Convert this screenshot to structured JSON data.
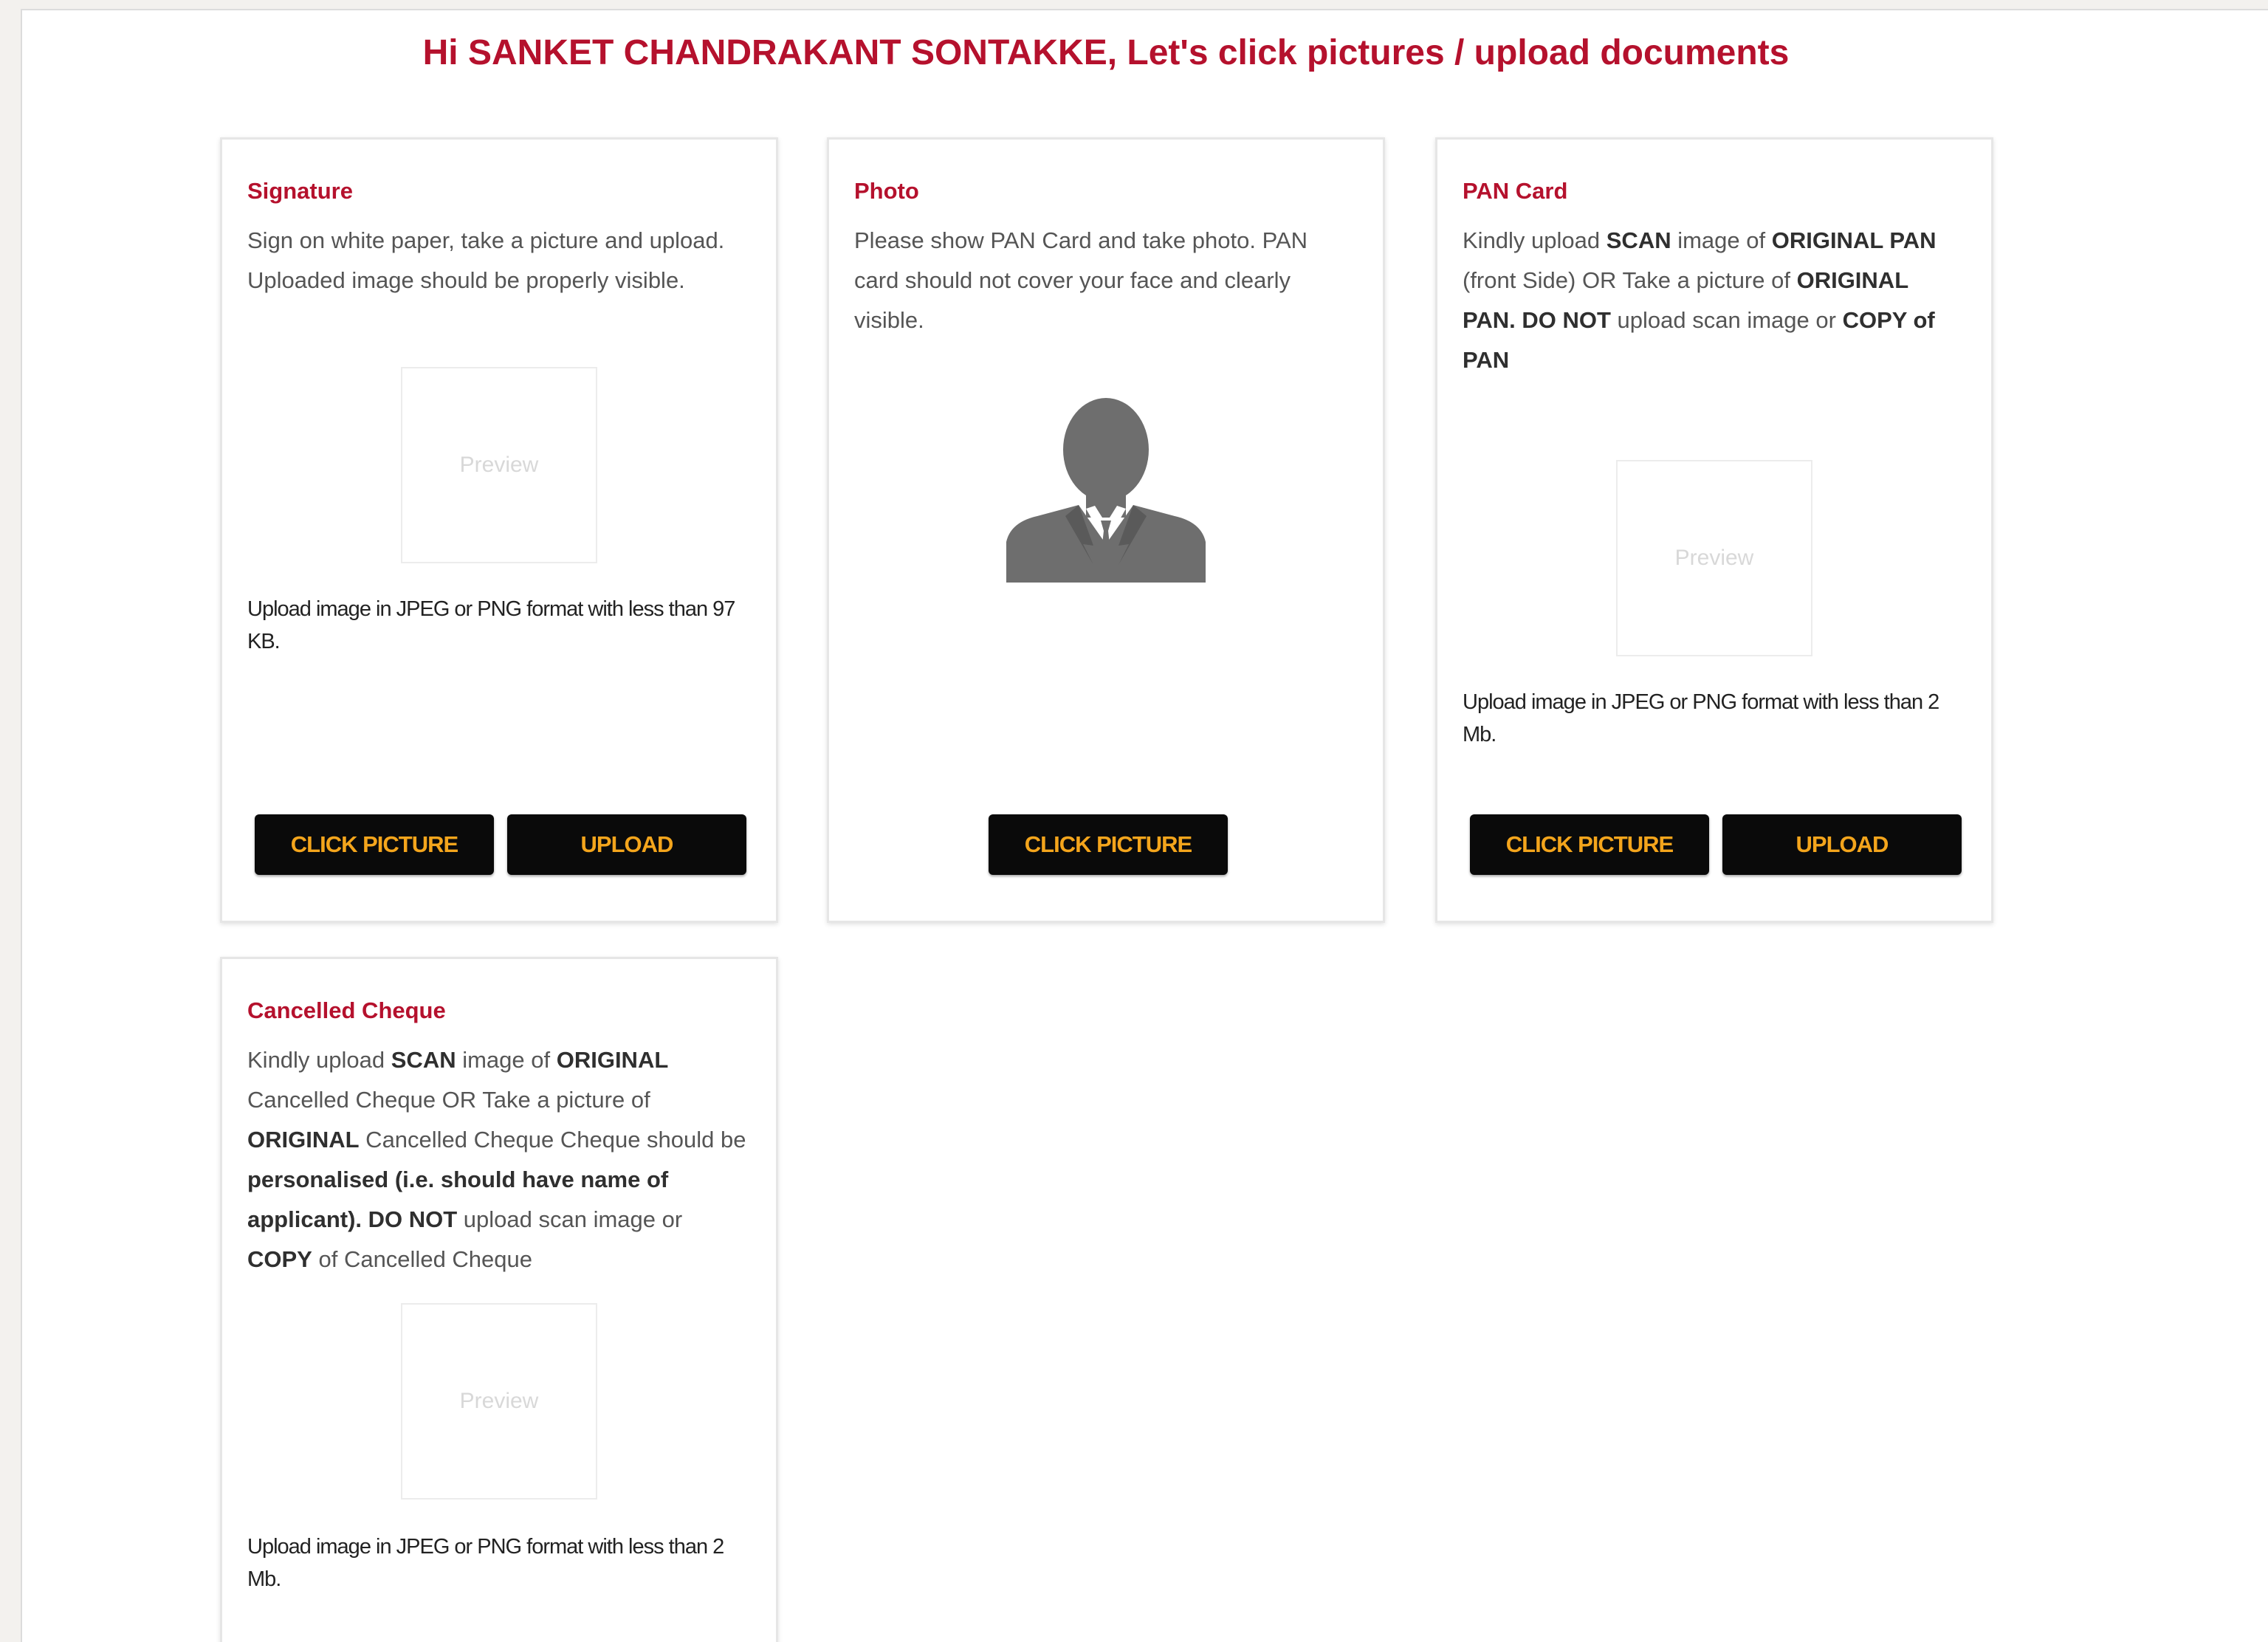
{
  "page": {
    "title": "Hi SANKET CHANDRAKANT SONTAKKE, Let's click pictures / upload documents"
  },
  "colors": {
    "accent": "#b5112d",
    "button_bg": "#0a0a0a",
    "button_text": "#f4a51c"
  },
  "cards": {
    "signature": {
      "title": "Signature",
      "desc": "Sign on white paper, take a picture and upload. Uploaded image should be properly visible.",
      "preview": "Preview",
      "note": "Upload image in JPEG or PNG format with less than 97 KB.",
      "click_label": "CLICK PICTURE",
      "upload_label": "UPLOAD"
    },
    "photo": {
      "title": "Photo",
      "desc": "Please show PAN Card and take photo. PAN card should not cover your face and clearly visible.",
      "avatar_icon": "person-silhouette-icon",
      "click_label": "CLICK PICTURE"
    },
    "pan": {
      "title": "PAN Card",
      "desc": {
        "t1": "Kindly upload ",
        "b1": "SCAN",
        "t2": " image of ",
        "b2": "ORIGINAL PAN",
        "t3": " (front Side) OR Take a picture of ",
        "b3": "ORIGINAL PAN. DO NOT",
        "t4": " upload scan image or ",
        "b4": "COPY of PAN"
      },
      "preview": "Preview",
      "note": "Upload image in JPEG or PNG format with less than 2 Mb.",
      "click_label": "CLICK PICTURE",
      "upload_label": "UPLOAD"
    },
    "cheque": {
      "title": "Cancelled Cheque",
      "desc": {
        "t1": "Kindly upload ",
        "b1": "SCAN",
        "t2": " image of ",
        "b2": "ORIGINAL",
        "t3": " Cancelled Cheque OR Take a picture of ",
        "b3": "ORIGINAL",
        "t4": " Cancelled Cheque Cheque should be ",
        "b4": "personalised (i.e. should have name of applicant). DO NOT",
        "t5": " upload scan image or ",
        "b5": "COPY",
        "t6": " of Cancelled Cheque"
      },
      "preview": "Preview",
      "note": "Upload image in JPEG or PNG format with less than 2 Mb."
    }
  }
}
